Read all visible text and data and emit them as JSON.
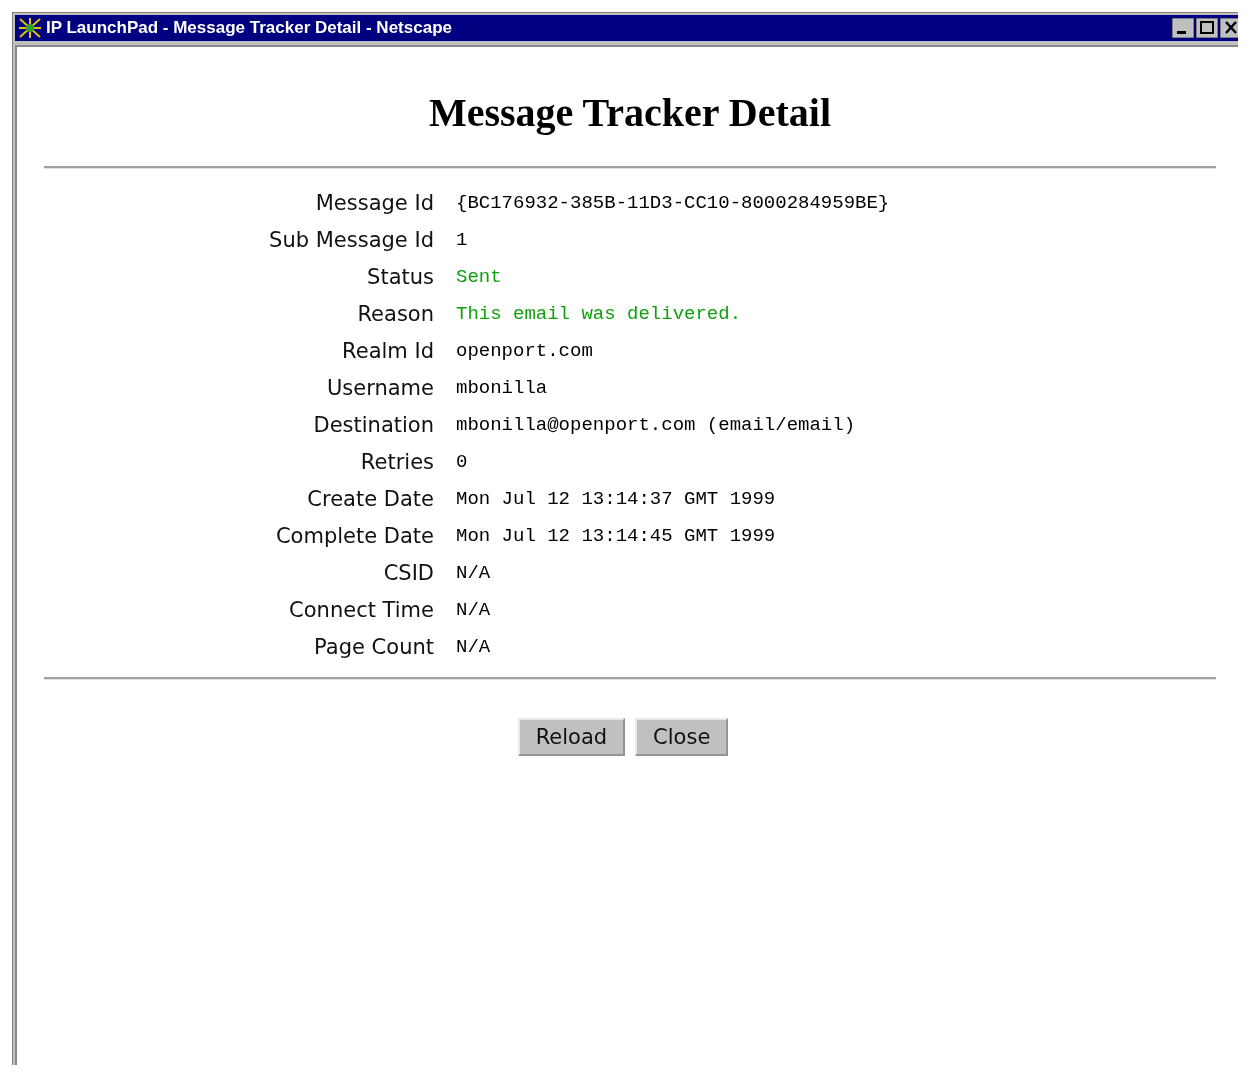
{
  "window": {
    "title": "IP LaunchPad - Message Tracker Detail - Netscape"
  },
  "heading": "Message Tracker Detail",
  "fields": [
    {
      "label": "Message Id",
      "value": "{BC176932-385B-11D3-CC10-8000284959BE}",
      "kind": "plain"
    },
    {
      "label": "Sub Message Id",
      "value": "1",
      "kind": "plain"
    },
    {
      "label": "Status",
      "value": "Sent",
      "kind": "success"
    },
    {
      "label": "Reason",
      "value": "This email was delivered.",
      "kind": "success"
    },
    {
      "label": "Realm Id",
      "value": "openport.com",
      "kind": "plain"
    },
    {
      "label": "Username",
      "value": "mbonilla",
      "kind": "plain"
    },
    {
      "label": "Destination",
      "value": "mbonilla@openport.com (email/email)",
      "kind": "plain"
    },
    {
      "label": "Retries",
      "value": "0",
      "kind": "plain"
    },
    {
      "label": "Create Date",
      "value": "Mon Jul 12 13:14:37 GMT 1999",
      "kind": "plain"
    },
    {
      "label": "Complete Date",
      "value": "Mon Jul 12 13:14:45 GMT 1999",
      "kind": "plain"
    },
    {
      "label": "CSID",
      "value": "N/A",
      "kind": "plain"
    },
    {
      "label": "Connect Time",
      "value": "N/A",
      "kind": "plain"
    },
    {
      "label": "Page Count",
      "value": "N/A",
      "kind": "plain"
    }
  ],
  "buttons": [
    "Reload",
    "Close"
  ]
}
